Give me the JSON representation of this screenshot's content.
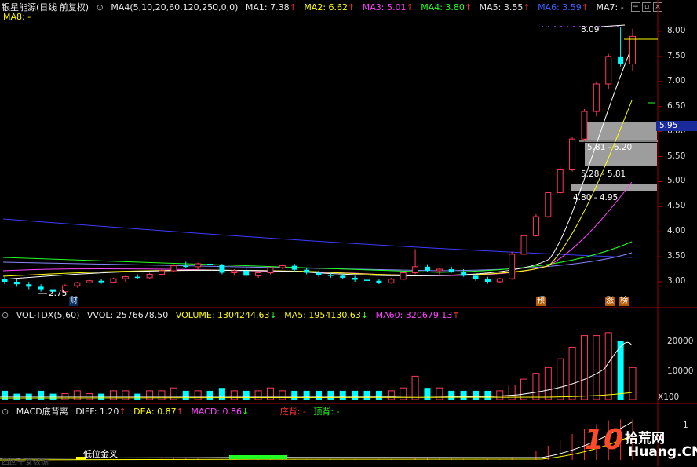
{
  "header": {
    "title": "银星能源(日线 前复权)",
    "ma_title": "MA4(5,10,20,60,120,250,0,0)",
    "ma1": "MA1: 7.38",
    "ma2": "MA2: 6.62",
    "ma3": "MA3: 5.01",
    "ma4": "MA4: 3.80",
    "ma5": "MA5: 3.55",
    "ma6": "MA6: 3.59",
    "ma7": "MA7: -",
    "ma8": "MA8: -",
    "arrow_up": "↑",
    "arrow_down": "↓"
  },
  "price_axis": [
    "8.00",
    "7.50",
    "7.00",
    "6.50",
    "6.00",
    "5.50",
    "5.00",
    "4.50",
    "4.00",
    "3.50",
    "3.00"
  ],
  "current_price": "5.95",
  "annotations": {
    "high": "8.09",
    "low": "2.75",
    "zone1": "5.81 - 6.20",
    "zone2": "5.28 - 5.81",
    "zone3": "4.80 - 4.95",
    "tag_cai": "财",
    "tag_yu": "预",
    "tag_zhang": "涨",
    "tag_bang": "榜"
  },
  "volume_panel": {
    "title": "VOL-TDX(5,60)",
    "vvol": "VVOL: 2576678.50",
    "volume": "VOLUME: 1304244.63",
    "ma5": "MA5: 1954130.63",
    "ma60": "MA60: 320679.13",
    "axis": [
      "20000",
      "10000"
    ],
    "unit": "X100"
  },
  "macd_panel": {
    "title": "MACD底背离",
    "diff": "DIFF: 1.20",
    "dea": "DEA: 0.87",
    "macd": "MACD: 0.86",
    "bottom_div": "底背: -",
    "top_div": "顶背: -",
    "golden_cross": "低位金叉",
    "bottom_text": "四回千女数据",
    "axis_top": "1"
  },
  "watermark": {
    "logo": "10",
    "brand": "拾荒网",
    "url": "Huang.CN"
  },
  "colors": {
    "up": "#ff3b5a",
    "down": "#00ffff",
    "ma1": "#ffffff",
    "ma2": "#ffff00",
    "ma3": "#ff44ff",
    "ma4": "#22ff22",
    "ma5": "#4a6cff",
    "ma6": "#3c3cff"
  },
  "chart_data": {
    "type": "candlestick",
    "title": "银星能源(日线 前复权)",
    "ylim": [
      2.6,
      8.2
    ],
    "candles": [
      [
        3.05,
        3.1,
        2.95,
        3.0
      ],
      [
        3.0,
        3.05,
        2.9,
        2.95
      ],
      [
        2.95,
        3.0,
        2.85,
        2.9
      ],
      [
        2.9,
        2.95,
        2.8,
        2.85
      ],
      [
        2.85,
        2.9,
        2.75,
        2.8
      ],
      [
        2.8,
        2.95,
        2.78,
        2.92
      ],
      [
        2.92,
        3.0,
        2.88,
        2.98
      ],
      [
        2.98,
        3.05,
        2.95,
        3.02
      ],
      [
        3.02,
        3.05,
        2.96,
        2.99
      ],
      [
        2.99,
        3.08,
        2.97,
        3.06
      ],
      [
        3.06,
        3.12,
        3.0,
        3.1
      ],
      [
        3.1,
        3.15,
        3.05,
        3.08
      ],
      [
        3.08,
        3.18,
        3.06,
        3.15
      ],
      [
        3.15,
        3.25,
        3.12,
        3.22
      ],
      [
        3.22,
        3.35,
        3.2,
        3.32
      ],
      [
        3.32,
        3.4,
        3.28,
        3.3
      ],
      [
        3.3,
        3.38,
        3.25,
        3.36
      ],
      [
        3.36,
        3.42,
        3.3,
        3.33
      ],
      [
        3.33,
        3.36,
        3.15,
        3.18
      ],
      [
        3.18,
        3.25,
        3.12,
        3.22
      ],
      [
        3.22,
        3.28,
        3.1,
        3.12
      ],
      [
        3.12,
        3.2,
        3.08,
        3.18
      ],
      [
        3.18,
        3.3,
        3.15,
        3.28
      ],
      [
        3.28,
        3.35,
        3.25,
        3.32
      ],
      [
        3.32,
        3.36,
        3.2,
        3.24
      ],
      [
        3.24,
        3.28,
        3.15,
        3.18
      ],
      [
        3.18,
        3.22,
        3.1,
        3.14
      ],
      [
        3.14,
        3.2,
        3.08,
        3.12
      ],
      [
        3.12,
        3.16,
        3.05,
        3.08
      ],
      [
        3.08,
        3.12,
        3.0,
        3.04
      ],
      [
        3.04,
        3.1,
        2.98,
        3.02
      ],
      [
        3.02,
        3.06,
        2.95,
        2.98
      ],
      [
        2.98,
        3.08,
        2.96,
        3.05
      ],
      [
        3.05,
        3.2,
        3.02,
        3.18
      ],
      [
        3.18,
        3.65,
        3.15,
        3.3
      ],
      [
        3.3,
        3.35,
        3.2,
        3.22
      ],
      [
        3.22,
        3.28,
        3.15,
        3.25
      ],
      [
        3.25,
        3.3,
        3.18,
        3.2
      ],
      [
        3.2,
        3.25,
        3.1,
        3.12
      ],
      [
        3.12,
        3.16,
        3.02,
        3.06
      ],
      [
        3.06,
        3.1,
        2.96,
        3.0
      ],
      [
        3.0,
        3.08,
        2.98,
        3.06
      ],
      [
        3.06,
        3.6,
        3.04,
        3.55
      ],
      [
        3.55,
        3.95,
        3.5,
        3.92
      ],
      [
        3.92,
        4.35,
        3.9,
        4.3
      ],
      [
        4.3,
        4.8,
        4.28,
        4.78
      ],
      [
        4.78,
        5.3,
        4.75,
        5.25
      ],
      [
        5.25,
        5.9,
        5.2,
        5.85
      ],
      [
        5.85,
        6.45,
        5.8,
        6.4
      ],
      [
        6.4,
        7.0,
        6.3,
        6.95
      ],
      [
        6.95,
        7.55,
        6.85,
        7.5
      ],
      [
        7.5,
        8.09,
        7.3,
        7.35
      ],
      [
        7.35,
        8.05,
        7.2,
        7.9
      ]
    ],
    "volume": [
      3,
      2,
      2,
      3,
      2,
      2,
      3,
      2,
      2,
      3,
      3,
      2,
      3,
      3,
      4,
      3,
      3,
      3,
      4,
      3,
      3,
      3,
      4,
      3,
      3,
      3,
      3,
      3,
      3,
      3,
      3,
      3,
      3,
      4,
      8,
      4,
      4,
      3,
      3,
      3,
      3,
      3,
      5,
      7,
      9,
      11,
      14,
      18,
      22,
      22,
      23,
      20,
      11
    ],
    "volume_ylim": [
      0,
      25000
    ],
    "macd": [
      0.02,
      0.01,
      0.0,
      -0.01,
      -0.01,
      0.0,
      0.01,
      0.01,
      0.01,
      0.02,
      0.02,
      0.02,
      0.02,
      0.03,
      0.03,
      0.03,
      0.03,
      0.02,
      0.02,
      0.02,
      0.02,
      0.02,
      0.02,
      0.02,
      0.02,
      0.02,
      0.02,
      0.02,
      0.02,
      0.02,
      0.02,
      0.02,
      0.02,
      0.03,
      0.04,
      0.04,
      0.03,
      0.03,
      0.02,
      0.02,
      0.02,
      0.02,
      0.06,
      0.12,
      0.2,
      0.3,
      0.42,
      0.55,
      0.66,
      0.76,
      0.84,
      0.86,
      0.86
    ]
  }
}
